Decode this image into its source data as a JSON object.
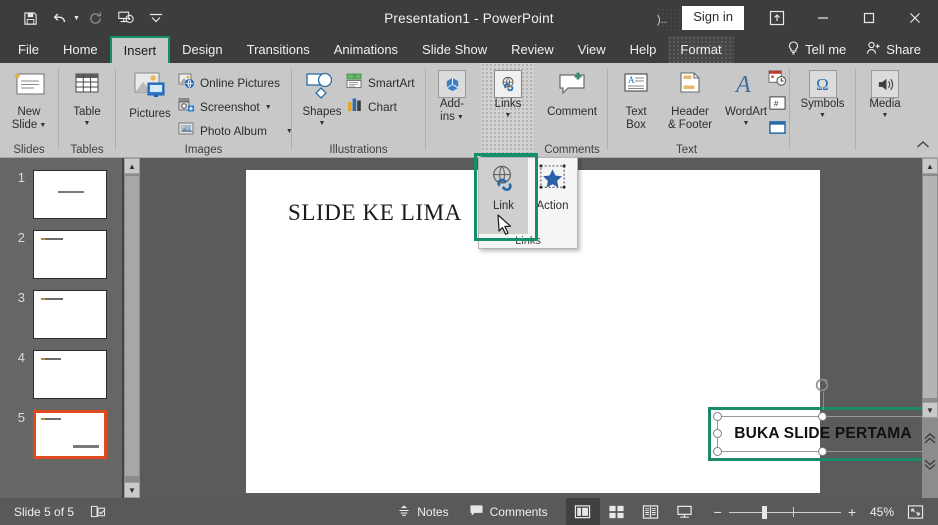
{
  "window": {
    "title": "Presentation1  -  PowerPoint",
    "signin_label": "Sign in",
    "tooltip_fragment": ").."
  },
  "quick_access": [
    {
      "name": "save-icon",
      "label": "Save"
    },
    {
      "name": "undo-icon",
      "label": "Undo"
    },
    {
      "name": "redo-icon",
      "label": "Redo"
    },
    {
      "name": "start-presentation-icon",
      "label": "Start From Beginning"
    },
    {
      "name": "customize-qat-icon",
      "label": "Customize Quick Access Toolbar"
    }
  ],
  "window_controls": [
    {
      "name": "ribbon-display-options-icon",
      "glyph": "ribbon"
    },
    {
      "name": "minimize-icon",
      "glyph": "minimize"
    },
    {
      "name": "maximize-icon",
      "glyph": "maximize"
    },
    {
      "name": "close-icon",
      "glyph": "close"
    }
  ],
  "tabs": [
    {
      "label": "File",
      "active": false
    },
    {
      "label": "Home",
      "active": false
    },
    {
      "label": "Insert",
      "active": true
    },
    {
      "label": "Design",
      "active": false
    },
    {
      "label": "Transitions",
      "active": false
    },
    {
      "label": "Animations",
      "active": false
    },
    {
      "label": "Slide Show",
      "active": false
    },
    {
      "label": "Review",
      "active": false
    },
    {
      "label": "View",
      "active": false
    },
    {
      "label": "Help",
      "active": false
    },
    {
      "label": "Format",
      "active": false,
      "contextual": true
    }
  ],
  "tabs_right": {
    "tell_me": "Tell me",
    "share": "Share"
  },
  "ribbon": {
    "groups": [
      {
        "name": "slides",
        "label": "Slides",
        "buttons": [
          {
            "label_1": "New",
            "label_2": "Slide",
            "icon": "new-slide-icon",
            "has_caret": true
          }
        ]
      },
      {
        "name": "tables",
        "label": "Tables",
        "buttons": [
          {
            "label_1": "Table",
            "label_2": "",
            "icon": "table-icon",
            "has_caret": true
          }
        ]
      },
      {
        "name": "images",
        "label": "Images",
        "buttons": [
          {
            "label_1": "Pictures",
            "label_2": "",
            "icon": "pictures-icon",
            "has_caret": false
          }
        ],
        "small_items": [
          {
            "label": "Online Pictures",
            "icon": "online-pictures-icon",
            "has_caret": false
          },
          {
            "label": "Screenshot",
            "icon": "screenshot-icon",
            "has_caret": true
          },
          {
            "label": "Photo Album",
            "icon": "photo-album-icon",
            "has_caret": true
          }
        ]
      },
      {
        "name": "illustrations",
        "label": "Illustrations",
        "buttons": [
          {
            "label_1": "Shapes",
            "label_2": "",
            "icon": "shapes-icon",
            "has_caret": true
          }
        ],
        "small_items": [
          {
            "label": "SmartArt",
            "icon": "smartart-icon",
            "has_caret": false
          },
          {
            "label": "Chart",
            "icon": "chart-icon",
            "has_caret": false
          }
        ]
      },
      {
        "name": "addins",
        "label": "",
        "buttons": [
          {
            "label_1": "Add-",
            "label_2": "ins",
            "icon": "addins-icon",
            "has_caret": true
          }
        ]
      },
      {
        "name": "links",
        "label": "",
        "highlighted": true,
        "buttons": [
          {
            "label_1": "Links",
            "label_2": "",
            "icon": "links-icon",
            "has_caret": true
          }
        ]
      },
      {
        "name": "comments",
        "label": "Comments",
        "buttons": [
          {
            "label_1": "Comment",
            "label_2": "",
            "icon": "comment-icon",
            "has_caret": false
          }
        ]
      },
      {
        "name": "text",
        "label": "Text",
        "buttons": [
          {
            "label_1": "Text",
            "label_2": "Box",
            "icon": "text-box-icon",
            "has_caret": false
          },
          {
            "label_1": "Header",
            "label_2": "& Footer",
            "icon": "header-footer-icon",
            "has_caret": false
          },
          {
            "label_1": "WordArt",
            "label_2": "",
            "icon": "wordart-icon",
            "has_caret": true
          }
        ],
        "stack_icons": [
          {
            "name": "date-time-icon"
          },
          {
            "name": "slide-number-icon"
          },
          {
            "name": "object-icon"
          }
        ]
      },
      {
        "name": "symbols",
        "label": "",
        "buttons": [
          {
            "label_1": "Symbols",
            "label_2": "",
            "icon": "symbols-icon",
            "glyph": "Ω",
            "has_caret": true
          }
        ]
      },
      {
        "name": "media",
        "label": "",
        "buttons": [
          {
            "label_1": "Media",
            "label_2": "",
            "icon": "media-icon",
            "has_caret": true
          }
        ]
      }
    ],
    "collapse_label": "Collapse the Ribbon"
  },
  "links_menu": {
    "group_label": "Links",
    "items": [
      {
        "label": "Link",
        "icon": "link-icon",
        "selected": true
      },
      {
        "label": "Action",
        "icon": "action-icon",
        "selected": false
      }
    ]
  },
  "thumbnails": [
    {
      "number": "1",
      "selected": false,
      "layout": "centered"
    },
    {
      "number": "2",
      "selected": false,
      "layout": "title"
    },
    {
      "number": "3",
      "selected": false,
      "layout": "title"
    },
    {
      "number": "4",
      "selected": false,
      "layout": "title"
    },
    {
      "number": "5",
      "selected": true,
      "layout": "title-plus-text"
    }
  ],
  "slide": {
    "title": "SLIDE KE LIMA",
    "textbox_value": "BUKA SLIDE PERTAMA"
  },
  "status_bar": {
    "slide_counter": "Slide 5 of 5",
    "accessibility_icon": "accessibility-checker-icon",
    "notes_label": "Notes",
    "comments_label": "Comments",
    "views": [
      {
        "name": "normal-view-button",
        "active": true
      },
      {
        "name": "slide-sorter-view-button",
        "active": false
      },
      {
        "name": "reading-view-button",
        "active": false
      },
      {
        "name": "slide-show-view-button",
        "active": false
      }
    ],
    "zoom_out": "−",
    "zoom_in": "+",
    "zoom_level": "45%",
    "fit_slide_icon": "fit-slide-to-window-icon"
  },
  "colors": {
    "accent_green": "#148f6e",
    "selection_orange": "#e04a1f",
    "titlebar": "#3d3d3d",
    "ribbon": "#c8c8c8",
    "canvas": "#5b5b5b",
    "statusbar": "#595959"
  }
}
